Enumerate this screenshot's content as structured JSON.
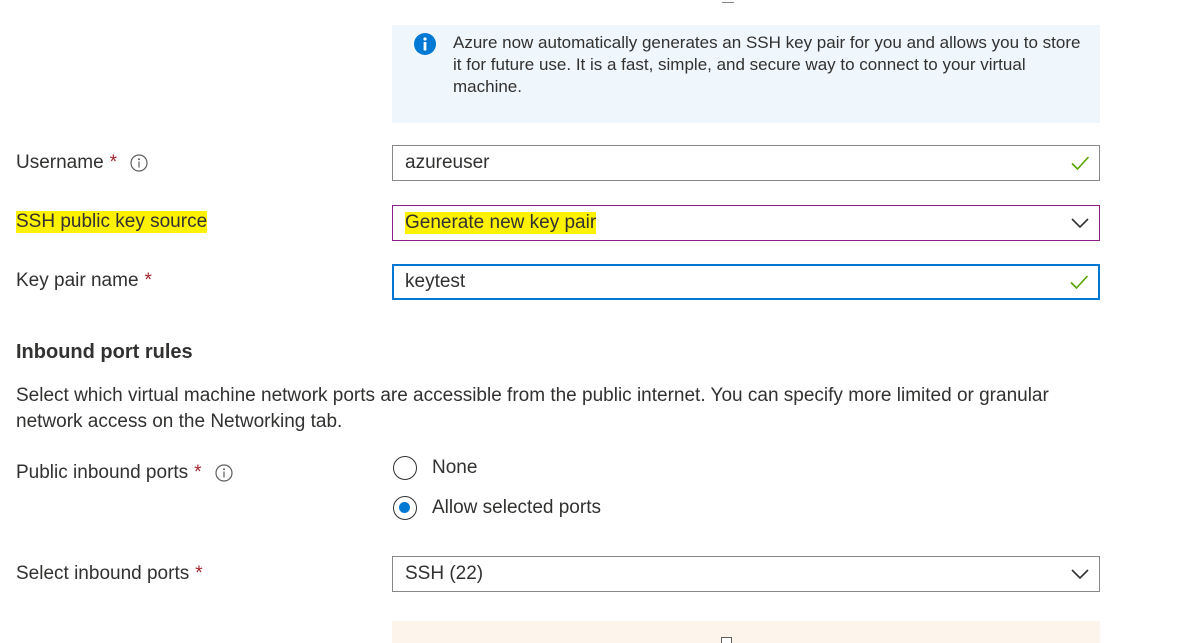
{
  "info": {
    "text": "Azure now automatically generates an SSH key pair for you and allows you to store it for future use. It is a fast, simple, and secure way to connect to your virtual machine.",
    "icon": "info-icon"
  },
  "username": {
    "label": "Username",
    "required_mark": "*",
    "value": "azureuser",
    "valid": true
  },
  "ssh_source": {
    "label": "SSH public key source",
    "value": "Generate new key pair",
    "highlight_color": "#fff200"
  },
  "key_pair_name": {
    "label": "Key pair name",
    "required_mark": "*",
    "value": "keytest",
    "valid": true
  },
  "inbound": {
    "title": "Inbound port rules",
    "description": "Select which virtual machine network ports are accessible from the public internet. You can specify more limited or granular network access on the Networking tab.",
    "public_ports_label": "Public inbound ports",
    "required_mark": "*",
    "options": [
      {
        "label": "None",
        "selected": false
      },
      {
        "label": "Allow selected ports",
        "selected": true
      }
    ],
    "select_ports_label": "Select inbound ports",
    "select_ports_value": "SSH (22)"
  },
  "colors": {
    "accent": "#0078d4",
    "required": "#a4262c",
    "valid_check": "#57a300",
    "info_bg": "#eff6fc",
    "warning_bg": "#fdf4ec"
  }
}
